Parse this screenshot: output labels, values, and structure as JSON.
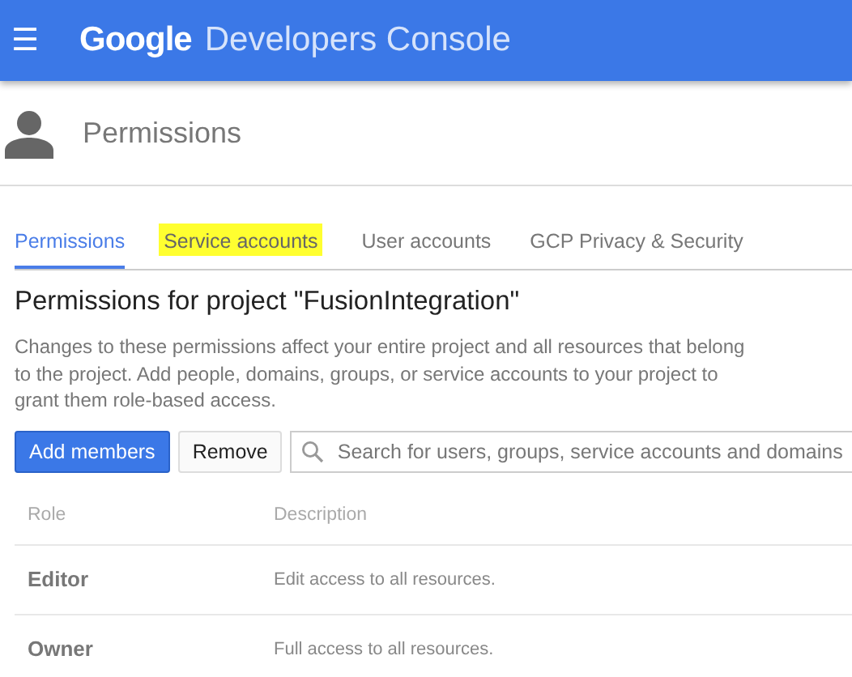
{
  "app_bar": {
    "menu_icon": "☰",
    "brand": "Google",
    "product": "Developers Console"
  },
  "page_header": {
    "title": "Permissions"
  },
  "tabs": [
    {
      "label": "Permissions",
      "selected": true,
      "highlighted": false
    },
    {
      "label": "Service accounts",
      "selected": false,
      "highlighted": true
    },
    {
      "label": "User accounts",
      "selected": false,
      "highlighted": false
    },
    {
      "label": "GCP Privacy & Security",
      "selected": false,
      "highlighted": false
    }
  ],
  "heading": "Permissions for project \"FusionIntegration\"",
  "description": "Changes to these permissions affect your entire project and all resources that belong to the project. Add people, domains, groups, or service accounts to your project to grant them role-based access.",
  "toolbar": {
    "buttons": [
      {
        "label": "Add members",
        "kind": "primary"
      },
      {
        "label": "Remove",
        "kind": "secondary"
      }
    ],
    "search": {
      "placeholder": "Search for users, groups, service accounts and domains"
    }
  },
  "table": {
    "columns": [
      "Role",
      "Description"
    ],
    "rows": [
      {
        "role": "Editor",
        "description": "Edit access to all resources."
      },
      {
        "role": "Owner",
        "description": "Full access to all resources."
      }
    ]
  }
}
